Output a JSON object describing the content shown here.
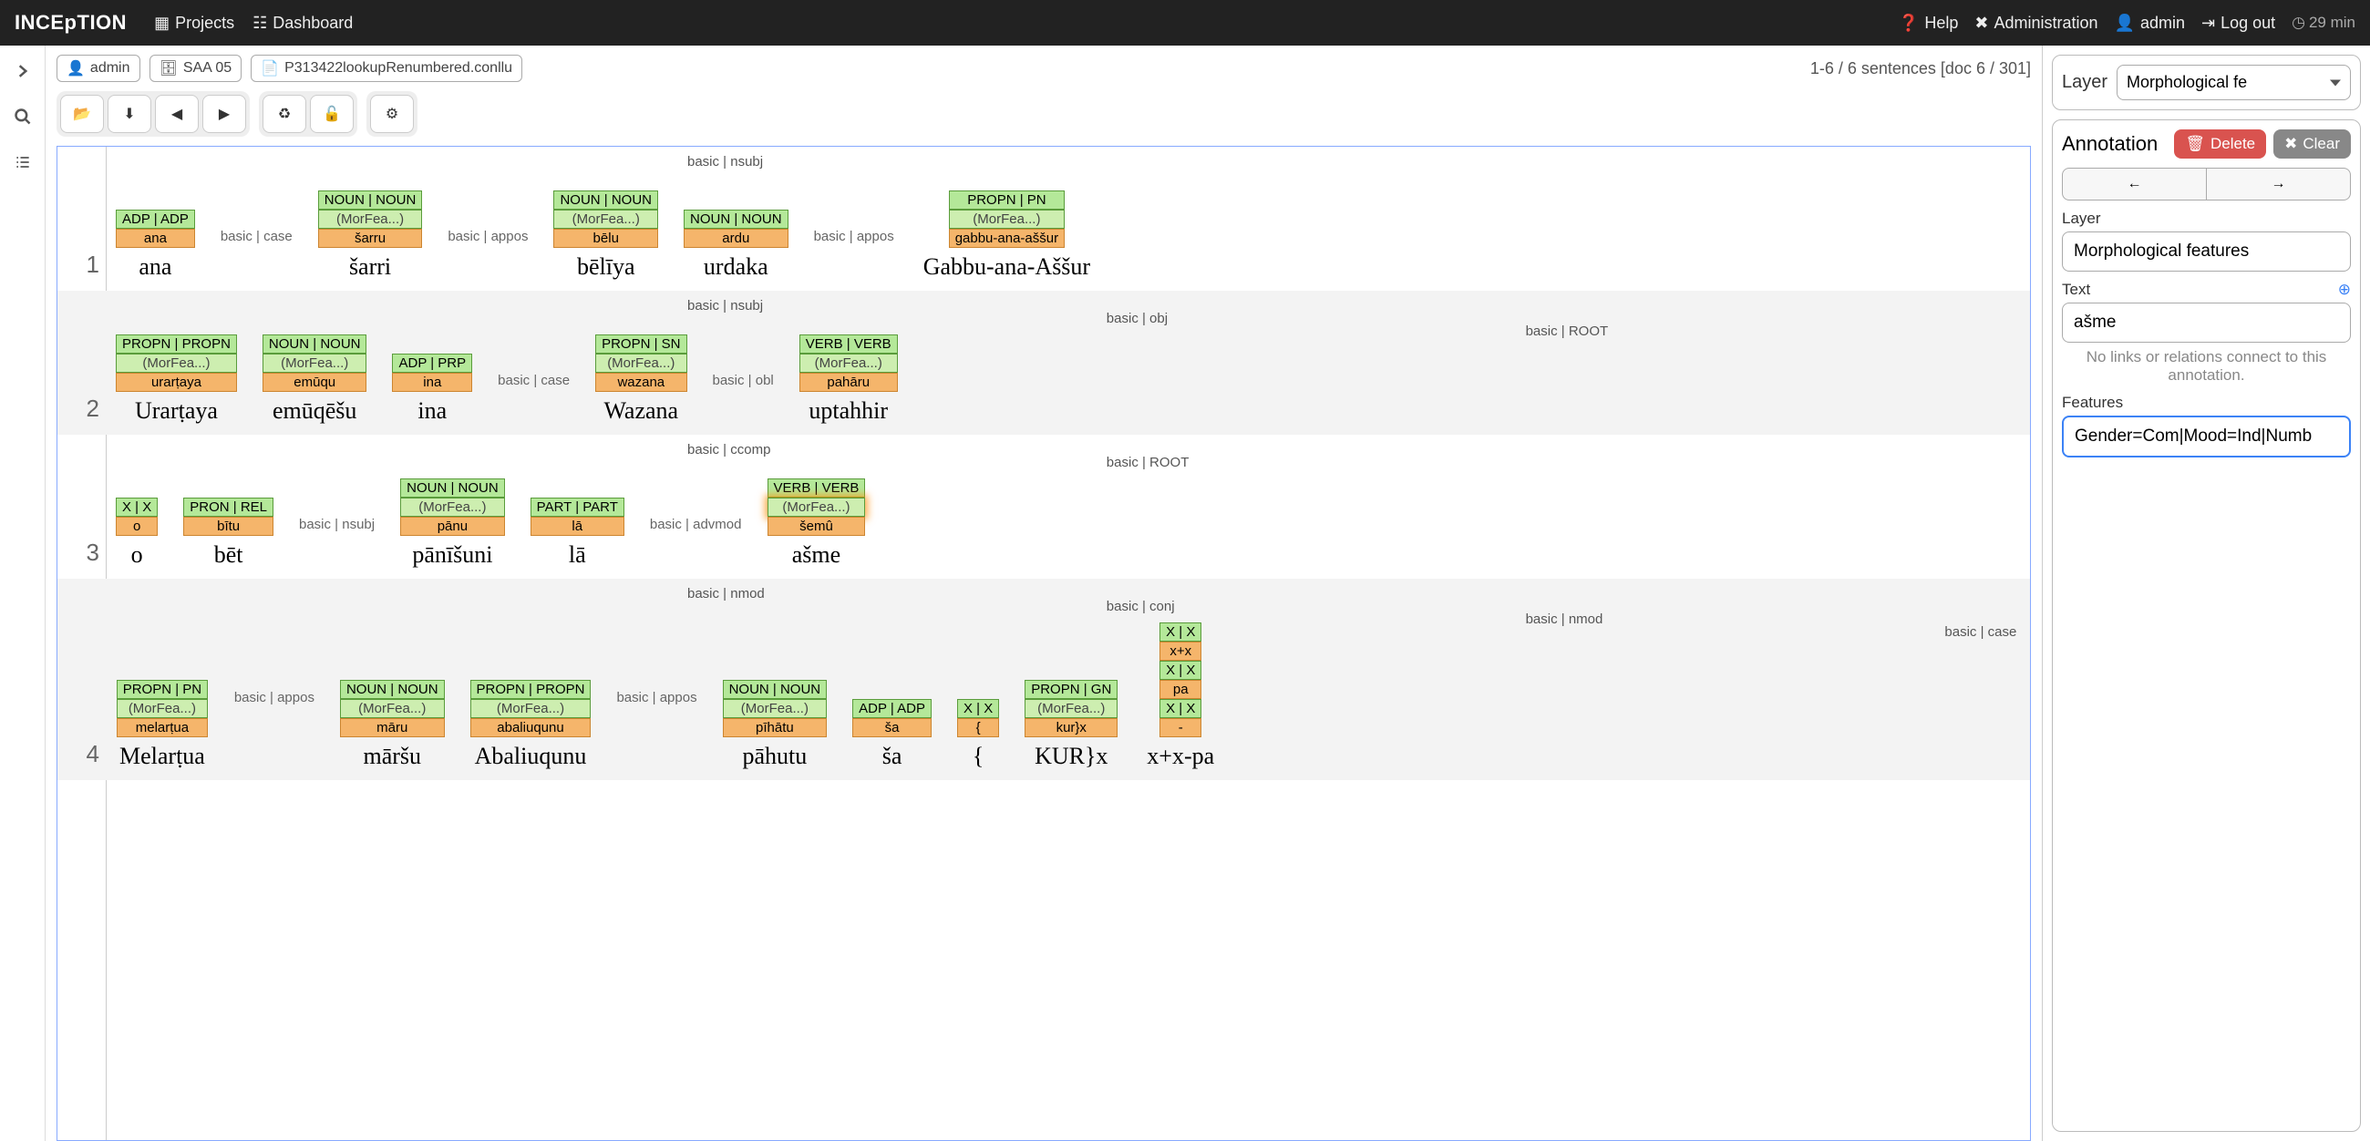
{
  "app": {
    "logo": "INCEpTION"
  },
  "nav": {
    "projects": "Projects",
    "dashboard": "Dashboard",
    "help": "Help",
    "administration": "Administration",
    "user": "admin",
    "logout": "Log out",
    "timer": "29 min"
  },
  "crumbs": {
    "user": "admin",
    "project": "SAA 05",
    "doc": "P313422lookupRenumbered.conllu"
  },
  "docinfo": "1-6 / 6 sentences [doc 6 / 301]",
  "sentences": [
    {
      "num": "1",
      "arcs": [
        "basic | nsubj"
      ],
      "tokens": [
        {
          "pos": "ADP | ADP",
          "morf": null,
          "lemma": "ana",
          "text": "ana",
          "rel_after": "basic | case"
        },
        {
          "pos": "NOUN | NOUN",
          "morf": "(MorFea...)",
          "lemma": "šarru",
          "text": "šarri",
          "rel_after": "basic | appos"
        },
        {
          "pos": "NOUN | NOUN",
          "morf": "(MorFea...)",
          "lemma": "bēlu",
          "text": "bēlīya",
          "rel_after": null
        },
        {
          "pos": "NOUN | NOUN",
          "morf": null,
          "lemma": "ardu",
          "text": "urdaka",
          "rel_after": "basic | appos"
        },
        {
          "pos": "PROPN | PN",
          "morf": "(MorFea...)",
          "lemma": "gabbu-ana-aššur",
          "text": "Gabbu-ana-Aššur",
          "rel_after": null
        }
      ]
    },
    {
      "num": "2",
      "arcs": [
        "basic | nsubj",
        "basic | obj",
        "basic | ROOT"
      ],
      "tokens": [
        {
          "pos": "PROPN | PROPN",
          "morf": "(MorFea...)",
          "lemma": "urarṭaya",
          "text": "Urarṭaya",
          "rel_after": null
        },
        {
          "pos": "NOUN | NOUN",
          "morf": "(MorFea...)",
          "lemma": "emūqu",
          "text": "emūqēšu",
          "rel_after": null
        },
        {
          "pos": "ADP | PRP",
          "morf": null,
          "lemma": "ina",
          "text": "ina",
          "rel_after": "basic | case"
        },
        {
          "pos": "PROPN | SN",
          "morf": "(MorFea...)",
          "lemma": "wazana",
          "text": "Wazana",
          "rel_after": "basic | obl"
        },
        {
          "pos": "VERB | VERB",
          "morf": "(MorFea...)",
          "lemma": "pahāru",
          "text": "uptahhir",
          "rel_after": null
        }
      ]
    },
    {
      "num": "3",
      "arcs": [
        "basic | ccomp",
        "basic | ROOT"
      ],
      "tokens": [
        {
          "pos": "X | X",
          "morf": null,
          "lemma": "o",
          "text": "o",
          "rel_after": null
        },
        {
          "pos": "PRON | REL",
          "morf": null,
          "lemma": "bītu",
          "text": "bēt",
          "rel_after": "basic | nsubj"
        },
        {
          "pos": "NOUN | NOUN",
          "morf": "(MorFea...)",
          "lemma": "pānu",
          "text": "pānīšuni",
          "rel_after": null
        },
        {
          "pos": "PART | PART",
          "morf": null,
          "lemma": "lā",
          "text": "lā",
          "rel_after": "basic | advmod"
        },
        {
          "pos": "VERB | VERB",
          "morf": "(MorFea...)",
          "lemma": "šemû",
          "text": "ašme",
          "sel": true,
          "rel_after": null
        }
      ]
    },
    {
      "num": "4",
      "arcs": [
        "basic | nmod",
        "basic | conj",
        "basic | nmod",
        "basic | case"
      ],
      "tokens": [
        {
          "pos": "PROPN | PN",
          "morf": "(MorFea...)",
          "lemma": "melarṭua",
          "text": "Melarṭua",
          "rel_after": "basic | appos"
        },
        {
          "pos": "NOUN | NOUN",
          "morf": "(MorFea...)",
          "lemma": "māru",
          "text": "māršu",
          "rel_after": null
        },
        {
          "pos": "PROPN | PROPN",
          "morf": "(MorFea...)",
          "lemma": "abaliuqunu",
          "text": "Abaliuqunu",
          "rel_after": "basic | appos"
        },
        {
          "pos": "NOUN | NOUN",
          "morf": "(MorFea...)",
          "lemma": "pīhātu",
          "text": "pāhutu",
          "rel_after": null
        },
        {
          "pos": "ADP | ADP",
          "morf": null,
          "lemma": "ša",
          "text": "ša",
          "rel_after": null
        },
        {
          "pos": "X | X",
          "morf": null,
          "lemma": "{",
          "text": "{",
          "rel_after": null
        },
        {
          "pos": "PROPN | GN",
          "morf": "(MorFea...)",
          "lemma": "kur}x",
          "text": "KUR}x",
          "rel_after": null
        },
        {
          "pos_stack": [
            "X | X",
            "X | X",
            "X | X"
          ],
          "lemma_stack": [
            "x+x",
            "pa",
            "-"
          ],
          "text": "x+x-pa",
          "rel_after": null
        }
      ]
    }
  ],
  "right": {
    "layer_label": "Layer",
    "layer_select": "Morphological fe",
    "annotation_title": "Annotation",
    "delete": "Delete",
    "clear": "Clear",
    "layer_field_label": "Layer",
    "layer_value": "Morphological features",
    "text_label": "Text",
    "text_value": "ašme",
    "hint": "No links or relations connect to this annotation.",
    "features_label": "Features",
    "features_value": "Gender=Com|Mood=Ind|Numb"
  }
}
